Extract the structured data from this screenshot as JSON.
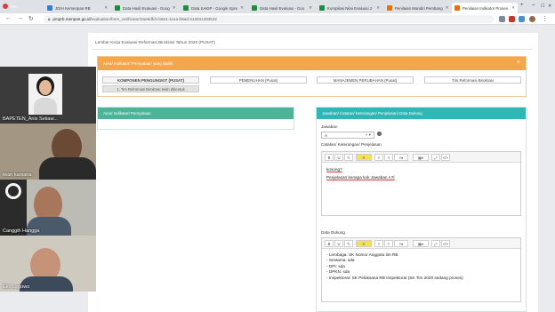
{
  "browser": {
    "recording_label": "Rec",
    "tabs": [
      {
        "label": "JDIH Kemenpan RB",
        "color": "#3a7bd5"
      },
      {
        "label": "Data Hasil Evaluasi - Goog",
        "color": "#1e8e3e"
      },
      {
        "label": "Data SAKIP - Google Spre",
        "color": "#1e8e3e"
      },
      {
        "label": "Data Hasil Evaluasi - Goo",
        "color": "#1e8e3e"
      },
      {
        "label": "Kompilasi Nilai Evaluasi 2",
        "color": "#1e8e3e"
      },
      {
        "label": "Penilaian Mandiri Pembang",
        "color": "#e8710a"
      },
      {
        "label": "Penilaian Indikator Proses",
        "color": "#e8710a"
      }
    ],
    "url_host": "pmprb.menpan.go.id",
    "url_path": "/evaluation/form_verificator/2ae6dfcb-b6e1-11ea-b8ad-313031393532"
  },
  "page": {
    "title": "Lembar Kerja Evaluasi Reformasi Birokrasi Tahun 2020 (PUSAT)",
    "orange_panel": {
      "header": "Area/ Indikator/ Pernyataan yang dipilih",
      "tabs": [
        "KOMPONEN PENGUNGKIT (PUSAT)",
        "PEMENUHAN (Pusat)",
        "MANAJEMEN PERUBAHAN (Pusat)",
        "Tim Reformasi Birokrasi"
      ],
      "sub_item": "1. Tim Reformasi Birokrasi telah dibentuk"
    },
    "green_panel": {
      "header": "Area/ Indikator/ Pernyataan"
    },
    "teal_panel": {
      "header": "Jawaban/ Catatan/ Keterangan/ Penjelasan/ Data Dukung",
      "jawaban_label": "Jawaban",
      "jawaban_value": "A",
      "catatan_label": "Catatan/ Keterangan/ Penjelasan",
      "catatan_lines": [
        "kosong?",
        "Penjelasan kenapa kok Jawaban A?|"
      ],
      "data_dukung_label": "Data Dukung",
      "data_dukung_lines": [
        "- Lembaga: SK Nomor Anggota tim RB",
        "- Sestama: sda",
        "- DPI: sda",
        "- DPKN: sda",
        "- Inspektorat: SK Pelaksana RB Inspektorat  (SK Tim 2020 sedang proses)"
      ]
    }
  },
  "toolbar": {
    "bold": "B",
    "underline": "U",
    "clear": "✎",
    "font_color": "A",
    "ul": "≡",
    "ol": "≡",
    "para": "≡▾",
    "table": "▦▾",
    "fullscreen": "⤢",
    "code": "</>"
  },
  "video_call": {
    "participants": [
      {
        "name": "BAPETEN_Anis Setiaw..."
      },
      {
        "name": "iwan karsana"
      },
      {
        "name": "Canggih Hangga"
      },
      {
        "name": "Eko Legowo"
      }
    ]
  }
}
